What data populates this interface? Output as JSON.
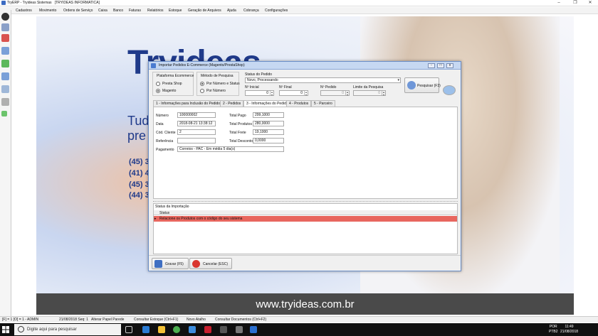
{
  "window": {
    "title": "TryERP - Tryideas Sistemas",
    "company": "[TRYIDEAS INFORMATICA]"
  },
  "menu": [
    "Cadastros",
    "Movimento",
    "Ordens de Serviço",
    "Caixa",
    "Banco",
    "Faturas",
    "Relatórios",
    "Estoque",
    "Geração de Arquivos",
    "Ajuda",
    "Cobrança",
    "Configurações"
  ],
  "wallpaper": {
    "logo": "Tryideas",
    "tagline1": "Tud",
    "tagline2": "pre",
    "phones": [
      "(45) 3",
      "(41) 4",
      "(45) 3",
      "(44) 3"
    ],
    "website": "www.tryideas.com.br"
  },
  "dialog": {
    "title": "Importar Pedidos E-Commerce (Magento/PrestaShop)",
    "plataforma": {
      "label": "Plataforma Ecommerce",
      "options": [
        "Presta Shop",
        "Magento"
      ],
      "selected": 1
    },
    "metodo": {
      "label": "Método de Pesquisa",
      "options": [
        "Por Número e Status",
        "Por Número"
      ],
      "selected": 0
    },
    "status_pedido": {
      "label": "Status do Pedido",
      "value": "Novo, Processando"
    },
    "filters": {
      "inicial_label": "Nº Inicial",
      "inicial_value": "0",
      "final_label": "Nº Final",
      "final_value": "0",
      "pedido_label": "Nº Pedido",
      "pedido_value": "0",
      "limite_label": "Limite da Pesquisa",
      "limite_value": "0"
    },
    "pesquisar_label": "Pesquisar (F3)",
    "tabs": [
      "1 - Informações para Inclusão do Pedido",
      "2 - Pedidos",
      "3 - Informações do Pedido",
      "4 - Produtos",
      "5 - Parceiro"
    ],
    "active_tab": 2,
    "info": {
      "numero_label": "Número",
      "numero": "100000002",
      "data_label": "Data",
      "data": "2018-08-21 13:38:12",
      "cliente_label": "Cód. Cliente",
      "cliente": "2",
      "referencia_label": "Referência",
      "referencia": "",
      "pagamento_label": "Pagamento",
      "pagamento": "Correios - PAC - Em média 5 dia(s)",
      "total_pago_label": "Total Pago",
      "total_pago": "299,1000",
      "total_produtos_label": "Total Produtos",
      "total_produtos": "280,0000",
      "total_frete_label": "Total Frete",
      "total_frete": "19,1000",
      "total_desconto_label": "Total Desconto",
      "total_desconto": "0,0000"
    },
    "import_status": {
      "section_label": "Status da Importação",
      "column": "Status",
      "rows": [
        "Relacione os Produtos com o código do seu sistema"
      ]
    },
    "gravar_label": "Gravar (F5)",
    "cancelar_label": "Cancelar (ESC)"
  },
  "statusbar": {
    "items": [
      "[F] = 1 [O] = 1 - ADMIN",
      "21/08/2018 Seq: 1",
      "Alterar Papel Parede",
      "Consultar Estoque (Ctrl+F1)",
      "Novo Atalho",
      "Consultar Documentos (Ctrl+F2)"
    ]
  },
  "taskbar": {
    "search_placeholder": "Digite aqui para pesquisar",
    "lang1": "POR",
    "lang2": "PTB2",
    "time": "11:49",
    "date": "21/08/2018"
  },
  "colors": {
    "accent": "#1f3a8a",
    "error_row": "#e8665e",
    "dialog_title": "#c6d8f2"
  }
}
